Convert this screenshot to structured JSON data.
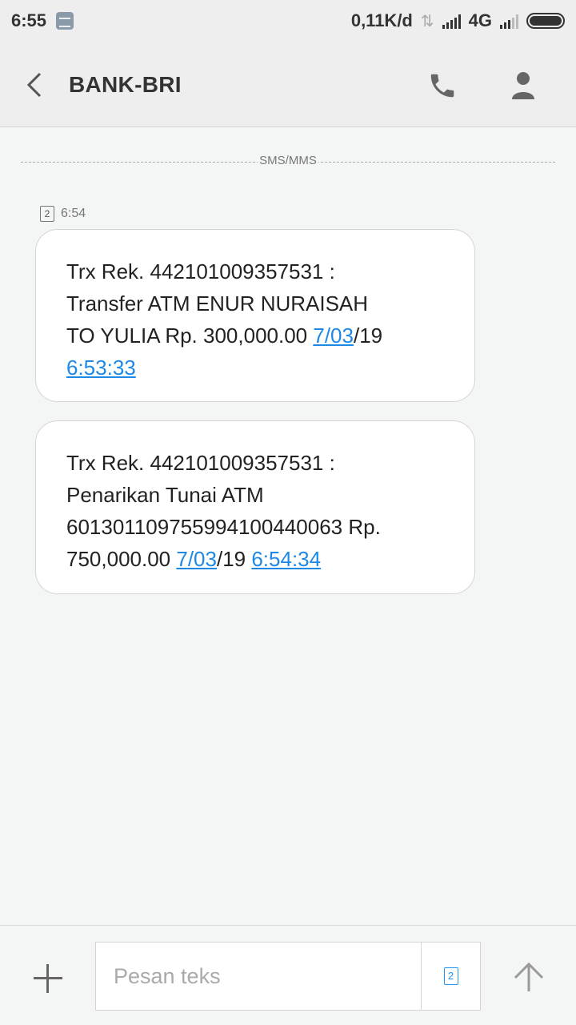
{
  "status_bar": {
    "time": "6:55",
    "net_speed": "0,11K/d",
    "network_type": "4G"
  },
  "header": {
    "contact_name": "BANK-BRI"
  },
  "thread": {
    "divider_label": "SMS/MMS",
    "sim_slot": "2",
    "time": "6:54",
    "messages": [
      {
        "lines": [
          "Trx Rek. 442101009357531 :",
          "Transfer ATM ENUR NURAISAH"
        ],
        "line3_text": "TO YULIA Rp. 300,000.00 ",
        "date_link": "7/03",
        "date_suffix": "/19",
        "time_link": "6:53:33"
      },
      {
        "lines": [
          "Trx Rek. 442101009357531 :",
          "Penarikan Tunai ATM",
          "6013011097559941004400​63 Rp."
        ],
        "line4_text": "750,000.00 ",
        "date_link": "7/03",
        "date_suffix": "/19 ",
        "time_link": "6:54:34"
      }
    ]
  },
  "composer": {
    "placeholder": "Pesan teks",
    "sim_slot": "2"
  },
  "colors": {
    "link": "#1e88e5",
    "background": "#f4f5f5",
    "bubble": "#ffffff"
  }
}
